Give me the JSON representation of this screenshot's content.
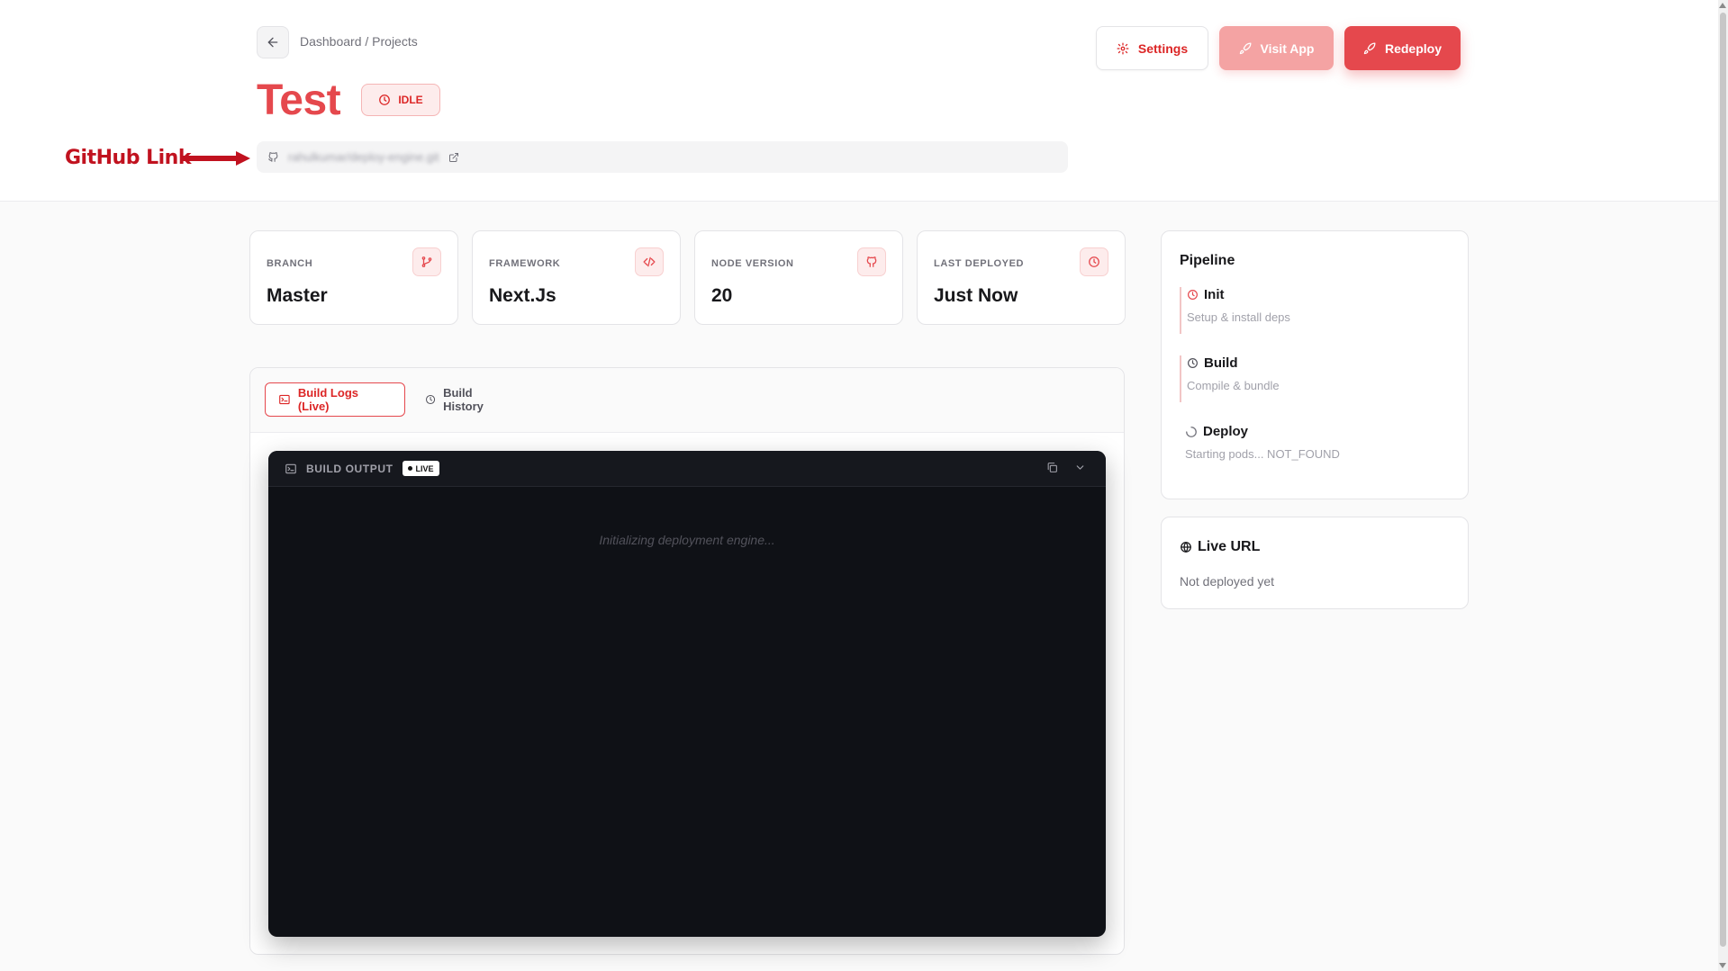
{
  "breadcrumb": "Dashboard / Projects",
  "project": {
    "title": "Test",
    "status": "IDLE",
    "repo_url": "rahulkumar/deploy-engine.git"
  },
  "annotation": {
    "label": "GitHub Link",
    "color": "#c1121f"
  },
  "actions": {
    "settings_label": "Settings",
    "visit_label": "Visit App",
    "redeploy_label": "Redeploy"
  },
  "stats": [
    {
      "label": "BRANCH",
      "value": "Master",
      "icon": "git-branch-icon"
    },
    {
      "label": "FRAMEWORK",
      "value": "Next.Js",
      "icon": "code-icon"
    },
    {
      "label": "NODE VERSION",
      "value": "20",
      "icon": "github-icon"
    },
    {
      "label": "LAST DEPLOYED",
      "value": "Just Now",
      "icon": "clock-icon"
    }
  ],
  "tabs": {
    "logs_label": "Build Logs (Live)",
    "history_label": "Build History"
  },
  "terminal": {
    "title": "BUILD OUTPUT",
    "badge": "LIVE",
    "message": "Initializing deployment engine..."
  },
  "pipeline": {
    "title": "Pipeline",
    "steps": [
      {
        "name": "Init",
        "desc": "Setup & install deps"
      },
      {
        "name": "Build",
        "desc": "Compile & bundle"
      },
      {
        "name": "Deploy",
        "desc": "Starting pods... NOT_FOUND"
      }
    ]
  },
  "live_url": {
    "title": "Live URL",
    "text": "Not deployed yet"
  },
  "colors": {
    "accent": "#e5484d",
    "accent_light": "#f4a3a3",
    "terminal_bg": "#0f1116"
  }
}
